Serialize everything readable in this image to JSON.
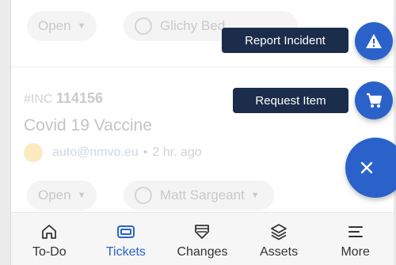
{
  "background_list": {
    "top_row": {
      "status": "Open",
      "assignee": "Glichy Bed..."
    },
    "ticket": {
      "prefix": "#INC",
      "number": "114156",
      "title": "Covid 19 Vaccine",
      "author": "auto@nmvo.eu",
      "separator": "•",
      "age": "2 hr. ago",
      "status": "Open",
      "assignee": "Matt Sargeant"
    }
  },
  "fab_menu": {
    "report_label": "Report Incident",
    "request_label": "Request Item",
    "report_icon": "warning-icon",
    "request_icon": "cart-icon",
    "close_icon": "close-icon"
  },
  "bottom_nav": {
    "items": [
      {
        "label": "To-Do",
        "icon": "home-icon",
        "active": false
      },
      {
        "label": "Tickets",
        "icon": "ticket-icon",
        "active": true
      },
      {
        "label": "Changes",
        "icon": "changes-icon",
        "active": false
      },
      {
        "label": "Assets",
        "icon": "layers-icon",
        "active": false
      },
      {
        "label": "More",
        "icon": "menu-icon",
        "active": false
      }
    ]
  },
  "colors": {
    "accent": "#2a62c9",
    "label_bg": "#1b2d4a",
    "nav_bg": "#f6f6f6"
  }
}
